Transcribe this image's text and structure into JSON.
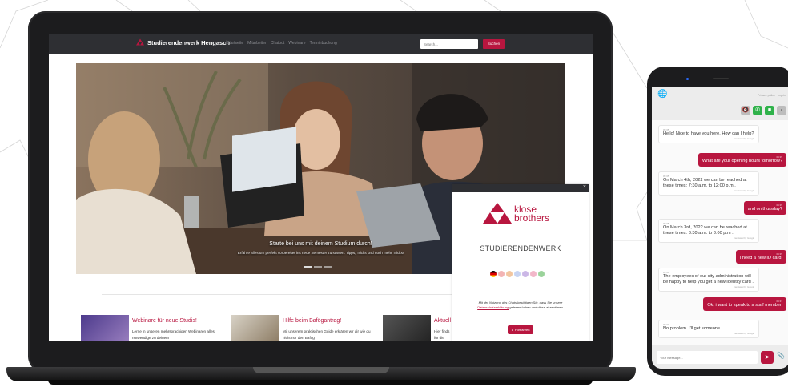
{
  "site": {
    "brand": "Studierendenwerk Hengasch",
    "nav_links": [
      "Startseite",
      "Mitarbeiter",
      "Chatbot",
      "Webinare",
      "Terminbuchung"
    ],
    "search_placeholder": "Search...",
    "search_button": "Suchen",
    "accent_color": "#b8163f"
  },
  "hero": {
    "title": "Starte bei uns mit deinem Studium durch!",
    "subtitle": "Erfahre alles um perfekt vorbereitet ins neue Semester zu starten. Tipps, Tricks und noch mehr Tricks!"
  },
  "cards": [
    {
      "title": "Webinare für neue Studis!",
      "text": "Lerne in unseren mehrsprachigen Webinaren alles notwendige zu deinem"
    },
    {
      "title": "Hilfe beim Bafögantrag!",
      "text": "Mit unserem praktischen Guide erklären wir dir wie du nicht nur den Bafög"
    },
    {
      "title": "Aktuell",
      "text": "Hier finds für die Me"
    }
  ],
  "popup": {
    "logo_line1": "klose",
    "logo_line2": "brothers",
    "title": "STUDIERENDENWERK",
    "consent_text": "Mit der Nutzung des Chats bestätigen Sie, dass Sie unsere",
    "consent_link": "Datenschutzerklärung",
    "consent_end": "gelesen haben und diese akzeptieren.",
    "continue_button": "Fortfahren",
    "flag_colors": [
      "#000000",
      "#f3b4b4",
      "#f2c6a0",
      "#c7d4f2",
      "#cbb7e6",
      "#f2b7c9",
      "#9bd39b"
    ]
  },
  "phone": {
    "header_links": "Privacy policy · Imprint",
    "input_placeholder": "Your message...",
    "google_label": "translated by Google",
    "messages": [
      {
        "from": "bot",
        "time": "09:35",
        "text": "Hello! Nice to have you here. How can I help?"
      },
      {
        "from": "user",
        "time": "09:35",
        "text": "What are your opening hours tomorrow?"
      },
      {
        "from": "bot",
        "time": "09:35",
        "text": "On March 4th, 2022 we can be reached at these times: 7:30 a.m. to 12:00 p.m ."
      },
      {
        "from": "user",
        "time": "09:35",
        "text": "and on thursday?"
      },
      {
        "from": "bot",
        "time": "09:35",
        "text": "On March 3rd, 2022 we can be reached at these times: 8:30 a.m. to 3:00 p.m ."
      },
      {
        "from": "user",
        "time": "09:35",
        "text": "I need a new ID card."
      },
      {
        "from": "bot",
        "time": "09:36",
        "text": "The employees of our city administration will be happy to help you get a new Identity card ."
      },
      {
        "from": "user",
        "time": "09:37",
        "text": "Ok, i want to speak to a staff member."
      },
      {
        "from": "bot",
        "time": "09:37",
        "text": "No problem. I'll get someone"
      }
    ]
  }
}
